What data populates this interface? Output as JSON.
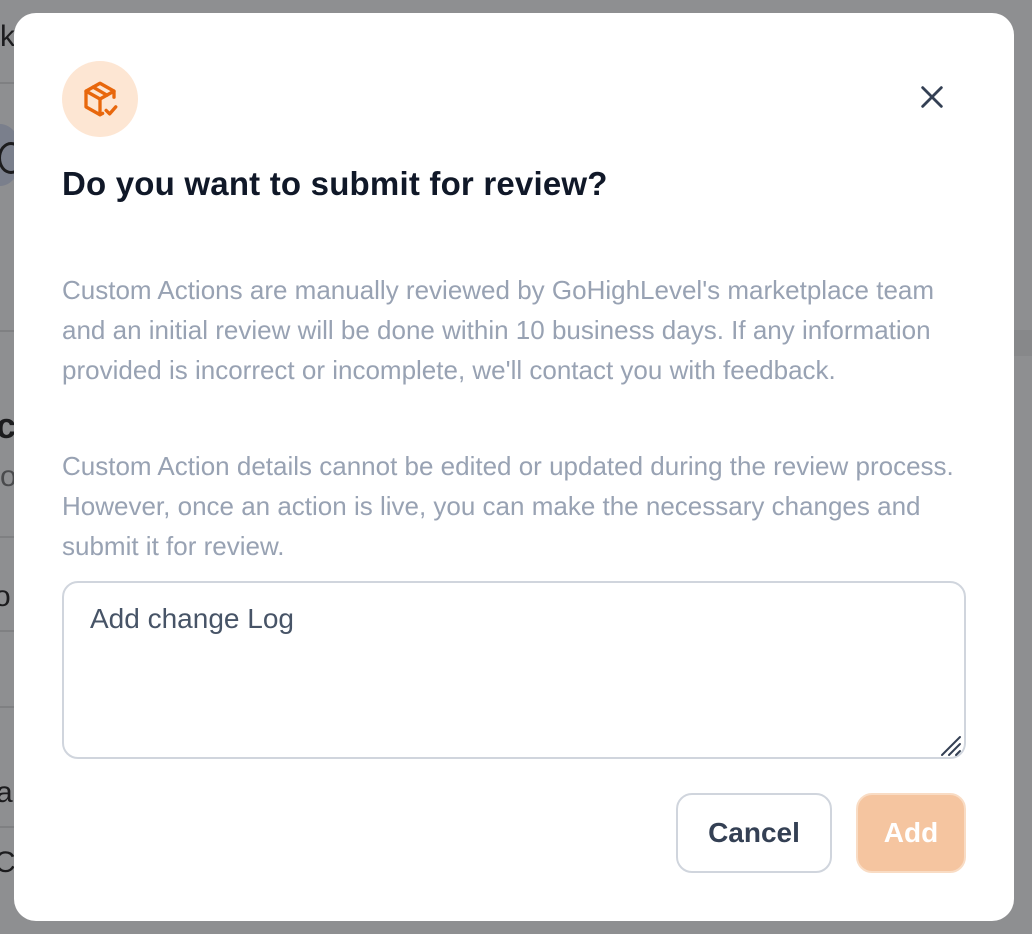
{
  "background": {
    "fragments": [
      "k",
      "ct",
      "o",
      "o",
      "ar",
      "C"
    ]
  },
  "dialog": {
    "icon": "package-check-icon",
    "close_icon": "close-icon",
    "title": "Do you want to submit for review?",
    "paragraph_1": "Custom Actions are manually reviewed by GoHighLevel's marketplace team and an initial review will be done within 10 business days. If any information provided is incorrect or incomplete, we'll contact you with feedback.",
    "paragraph_2": "Custom Action details cannot be edited or updated during the review process. However, once an action is live, you can make the necessary changes and submit it for review.",
    "changelog_placeholder": "Add change Log",
    "changelog_value": "",
    "cancel_label": "Cancel",
    "add_label": "Add"
  },
  "colors": {
    "accent": "#f79009",
    "icon_bg": "#fde6d3",
    "add_button_disabled": "#f5c5a0",
    "title": "#101828",
    "muted_text": "#98a2b3"
  }
}
